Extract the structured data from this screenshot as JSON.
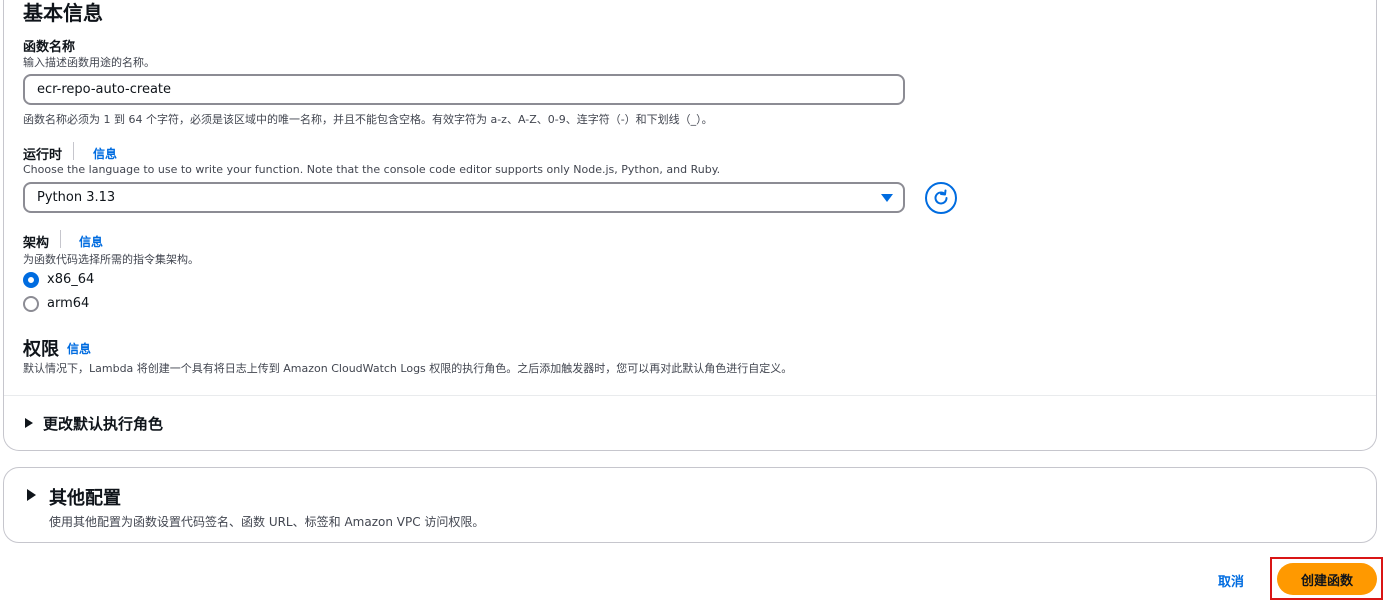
{
  "basic_info": {
    "title": "基本信息",
    "function_name": {
      "label": "函数名称",
      "description": "输入描述函数用途的名称。",
      "value": "ecr-repo-auto-create",
      "constraint": "函数名称必须为 1 到 64 个字符，必须是该区域中的唯一名称，并且不能包含空格。有效字符为 a-z、A-Z、0-9、连字符（-）和下划线（_）。"
    },
    "runtime": {
      "label": "运行时",
      "info_link": "信息",
      "description": "Choose the language to use to write your function. Note that the console code editor supports only Node.js, Python, and Ruby.",
      "selected": "Python 3.13",
      "refresh_icon": "refresh-icon"
    },
    "architecture": {
      "label": "架构",
      "info_link": "信息",
      "description": "为函数代码选择所需的指令集架构。",
      "options": [
        {
          "label": "x86_64",
          "checked": true
        },
        {
          "label": "arm64",
          "checked": false
        }
      ]
    },
    "permissions": {
      "title": "权限",
      "info_link": "信息",
      "description": "默认情况下，Lambda 将创建一个具有将日志上传到 Amazon CloudWatch Logs 权限的执行角色。之后添加触发器时，您可以再对此默认角色进行自定义。",
      "expander_label": "更改默认执行角色"
    }
  },
  "other_config": {
    "title": "其他配置",
    "description": "使用其他配置为函数设置代码签名、函数 URL、标签和 Amazon VPC 访问权限。"
  },
  "footer": {
    "cancel_label": "取消",
    "create_label": "创建函数"
  },
  "colors": {
    "link": "#006ce0",
    "primary_button": "#ff9900",
    "highlight_border": "#d91515"
  }
}
